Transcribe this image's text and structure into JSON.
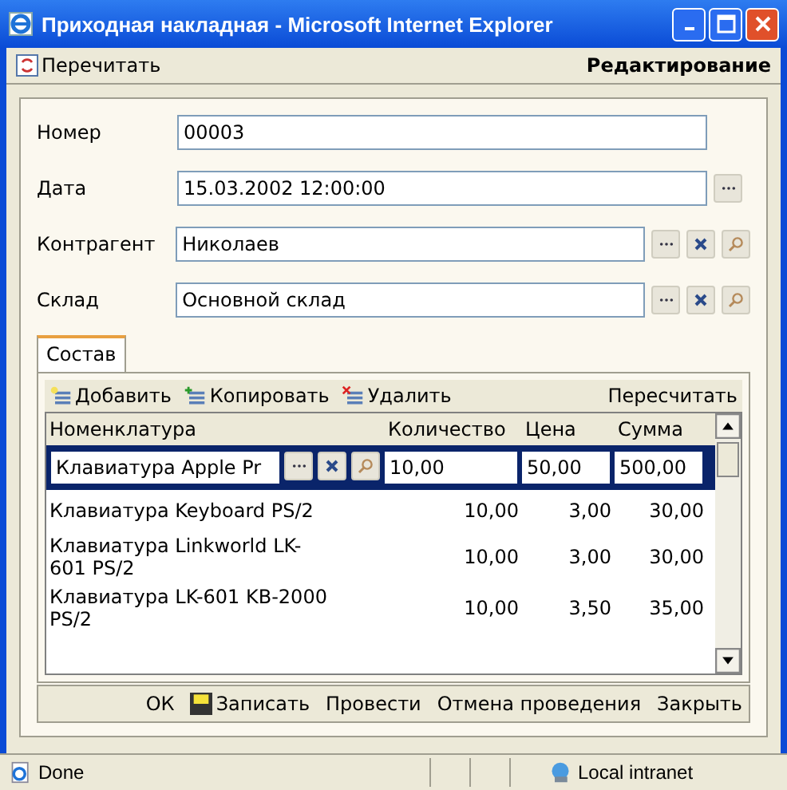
{
  "window": {
    "title": "Приходная накладная - Microsoft Internet Explorer"
  },
  "toolbar": {
    "refresh": "Перечитать",
    "mode": "Редактирование"
  },
  "fields": [
    {
      "label": "Номер",
      "value": "00003",
      "kind": "plain"
    },
    {
      "label": "Дата",
      "value": "15.03.2002 12:00:00",
      "kind": "date"
    },
    {
      "label": "Контрагент",
      "value": "Николаев",
      "kind": "ref"
    },
    {
      "label": "Склад",
      "value": "Основной склад",
      "kind": "ref"
    }
  ],
  "tabs": [
    {
      "label": "Состав",
      "selected": true
    }
  ],
  "grid_toolbar": {
    "actions": [
      {
        "label": "Добавить",
        "kind": "add"
      },
      {
        "label": "Копировать",
        "kind": "copy"
      },
      {
        "label": "Удалить",
        "kind": "delete"
      }
    ],
    "recalc": "Пересчитать"
  },
  "table": {
    "columns": [
      "Номенклатура",
      "Количество",
      "Цена",
      "Сумма"
    ],
    "rows": [
      {
        "kind": "edit",
        "selected": true,
        "cells": [
          "Клавиатура Apple Pr",
          "10,00",
          "50,00",
          "500,00"
        ]
      },
      {
        "kind": "plain",
        "selected": false,
        "cells": [
          "Клавиатура Keyboard PS/2",
          "10,00",
          "3,00",
          "30,00"
        ]
      },
      {
        "kind": "plain",
        "selected": false,
        "cells": [
          "Клавиатура Linkworld LK-601 PS/2",
          "10,00",
          "3,00",
          "30,00"
        ]
      },
      {
        "kind": "plain",
        "selected": false,
        "cells": [
          "Клавиатура LK-601 KB-2000 PS/2",
          "10,00",
          "3,50",
          "35,00"
        ]
      }
    ]
  },
  "footer_buttons": [
    {
      "label": "ОК",
      "kind": "plain"
    },
    {
      "label": "Записать",
      "kind": "save"
    },
    {
      "label": "Провести",
      "kind": "plain"
    },
    {
      "label": "Отмена проведения",
      "kind": "plain"
    },
    {
      "label": "Закрыть",
      "kind": "plain"
    }
  ],
  "status_bar": {
    "text": "Done",
    "zone": "Local intranet"
  }
}
